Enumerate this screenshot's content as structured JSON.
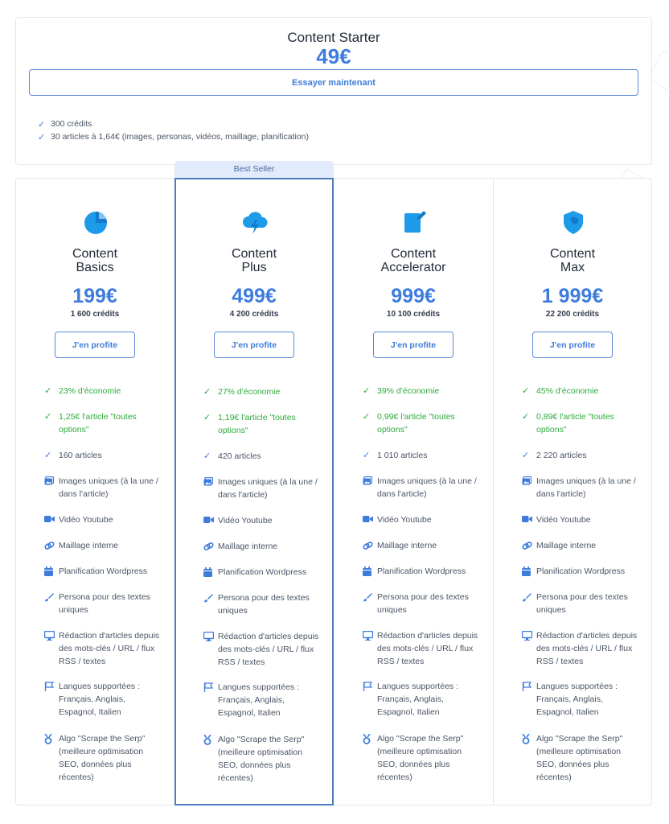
{
  "starter": {
    "name": "Content Starter",
    "price": "49€",
    "button": "Essayer maintenant",
    "features": [
      "300 crédits",
      "30 articles à 1,64€ (images, personas, vidéos, maillage, planification)"
    ]
  },
  "badge": "Best Seller",
  "plans": [
    {
      "name_line1": "Content",
      "name_line2": "Basics",
      "price": "199€",
      "credits": "1 600 crédits",
      "button": "J'en profite",
      "economy": "23% d'économie",
      "article_price": "1,25€ l'article \"toutes options\"",
      "articles": "160 articles"
    },
    {
      "name_line1": "Content",
      "name_line2": "Plus",
      "price": "499€",
      "credits": "4 200 crédits",
      "button": "J'en profite",
      "economy": "27% d'économie",
      "article_price": "1,19€ l'article \"toutes options\"",
      "articles": "420 articles"
    },
    {
      "name_line1": "Content",
      "name_line2": "Accelerator",
      "price": "999€",
      "credits": "10 100 crédits",
      "button": "J'en profite",
      "economy": "39% d'économie",
      "article_price": "0,99€ l'article \"toutes options\"",
      "articles": "1 010 articles"
    },
    {
      "name_line1": "Content",
      "name_line2": "Max",
      "price": "1 999€",
      "credits": "22 200 crédits",
      "button": "J'en profite",
      "economy": "45% d'économie",
      "article_price": "0,89€ l'article \"toutes options\"",
      "articles": "2 220 articles"
    }
  ],
  "common_features": {
    "images": "Images uniques (à la une / dans l'article)",
    "video": "Vidéo Youtube",
    "maillage": "Maillage interne",
    "planification": "Planification Wordpress",
    "persona": "Persona pour des textes uniques",
    "redaction": "Rédaction d'articles depuis des mots-clés / URL / flux RSS / textes",
    "langues": "Langues supportées : Français, Anglais, Espagnol, Italien",
    "algo": "Algo \"Scrape the Serp\" (meilleure optimisation SEO, données plus récentes)"
  },
  "icons": {
    "basics": "pie-chart-icon",
    "plus": "cloud-lightning-icon",
    "accelerator": "edit-document-icon",
    "max": "shield-icon",
    "images": "image-icon",
    "video": "video-camera-icon",
    "maillage": "link-icon",
    "planification": "calendar-icon",
    "persona": "brush-icon",
    "redaction": "monitor-icon",
    "langues": "flag-icon",
    "algo": "medal-icon"
  },
  "colors": {
    "accent": "#3e7cdc",
    "green": "#2eab3c",
    "badge_bg": "#e1ebfb",
    "highlight_border": "#4c7bbf"
  }
}
